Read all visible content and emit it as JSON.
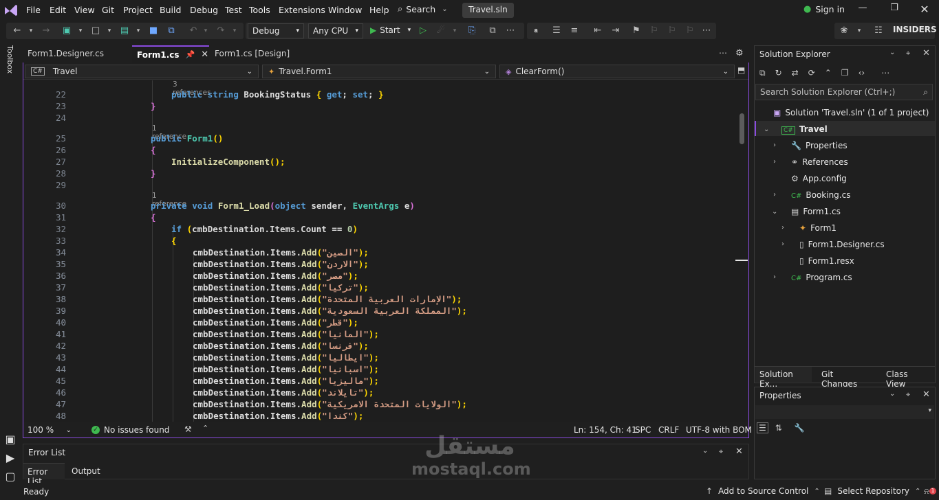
{
  "menubar": {
    "items": [
      "File",
      "Edit",
      "View",
      "Git",
      "Project",
      "Build",
      "Debug",
      "Test",
      "Tools",
      "Extensions",
      "Window",
      "Help"
    ],
    "search_label": "Search",
    "solution_name": "Travel.sln",
    "sign_in": "Sign in"
  },
  "toolbar": {
    "configuration": "Debug",
    "platform": "Any CPU",
    "start_label": "Start",
    "insiders": "INSIDERS"
  },
  "toolbox_label": "Toolbox",
  "editor": {
    "tabs": [
      {
        "label": "Form1.Designer.cs"
      },
      {
        "label": "Form1.cs"
      },
      {
        "label": "Form1.cs [Design]"
      }
    ],
    "nav": {
      "project": "Travel",
      "class": "Travel.Form1",
      "member": "ClearForm()"
    },
    "line_numbers": [
      "22",
      "23",
      "24",
      "25",
      "26",
      "27",
      "28",
      "29",
      "30",
      "31",
      "32",
      "33",
      "34",
      "35",
      "36",
      "37",
      "38",
      "39",
      "40",
      "41",
      "42",
      "43",
      "44",
      "45",
      "46",
      "47",
      "48"
    ],
    "refs": {
      "r22": "3 references",
      "r25": "1 reference",
      "r30": "1 reference"
    },
    "code": {
      "l22_kw1": "public",
      "l22_kw2": "string",
      "l22_name": "BookingStatus",
      "l22_brace_open": "{",
      "l22_get": "get",
      "l22_semi1": ";",
      "l22_set": "set",
      "l22_semi2": ";",
      "l22_brace_close": "}",
      "l23": "}",
      "l25_kw": "public",
      "l25_name": "Form1",
      "l25_paren": "()",
      "l26": "{",
      "l27_call": "InitializeComponent",
      "l27_rest": "();",
      "l28": "}",
      "l30_kw1": "private",
      "l30_kw2": "void",
      "l30_name": "Form1_Load",
      "l30_p1": "(",
      "l30_kw3": "object",
      "l30_arg1": "sender",
      "l30_comma": ",",
      "l30_type": "EventArgs",
      "l30_arg2": "e",
      "l30_p2": ")",
      "l31": "{",
      "l32_kw": "if",
      "l32_p1": "(",
      "l32_expr": "cmbDestination.Items.Count ==",
      "l32_num": "0",
      "l32_p2": ")",
      "l33": "{",
      "add_prefix": "cmbDestination.Items.",
      "add_method": "Add",
      "add_lines": [
        "\"الصين\"",
        "\"الاردن\"",
        "\"مصر\"",
        "\"تركيا\"",
        "\"الإمارات العربية المتحدة\"",
        "\"المملكة العربية السعودية\"",
        "\"قطر\"",
        "\"المانيا\"",
        "\"فرنسا\"",
        "\"ايطاليا\"",
        "\"اسبانيا\"",
        "\"ماليزيا\"",
        "\"تايلاند\"",
        "\"الولايات المتحدة الامريكية\"",
        "\"كندا\""
      ],
      "add_suffix": ");"
    },
    "status": {
      "zoom": "100 %",
      "issues": "No issues found",
      "position": "Ln: 154, Ch: 41",
      "spc": "SPC",
      "eol": "CRLF",
      "encoding": "UTF-8 with BOM"
    }
  },
  "error_panel": {
    "title": "Error List",
    "tabs": [
      "Error List",
      "Output"
    ]
  },
  "solution_explorer": {
    "title": "Solution Explorer",
    "search_placeholder": "Search Solution Explorer (Ctrl+;)",
    "items": [
      {
        "label": "Solution 'Travel.sln' (1 of 1 project)"
      },
      {
        "label": "Travel"
      },
      {
        "label": "Properties"
      },
      {
        "label": "References"
      },
      {
        "label": "App.config"
      },
      {
        "label": "Booking.cs"
      },
      {
        "label": "Form1.cs"
      },
      {
        "label": "Form1"
      },
      {
        "label": "Form1.Designer.cs"
      },
      {
        "label": "Form1.resx"
      },
      {
        "label": "Program.cs"
      }
    ],
    "bottom_tabs": [
      "Solution Ex...",
      "Git Changes",
      "Class View"
    ]
  },
  "properties_panel": {
    "title": "Properties"
  },
  "statusbar": {
    "ready": "Ready",
    "source_control": "Add to Source Control",
    "repository": "Select Repository",
    "notification_count": "1"
  },
  "watermark": {
    "arabic": "مستقل",
    "latin": "mostaql.com"
  },
  "colors": {
    "accent": "#8a4be0",
    "keyword": "#569cd6",
    "type": "#4ec9b0",
    "method": "#dcdcaa",
    "string": "#d69d85",
    "number": "#b5cea8",
    "brace_1": "#d670d6",
    "brace_2": "#ffd700",
    "success": "#3fb950"
  }
}
